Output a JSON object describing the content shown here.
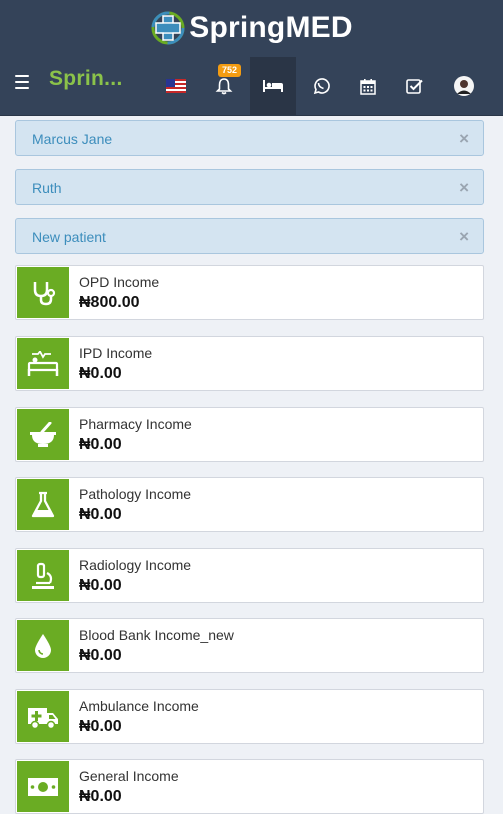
{
  "app": {
    "logo_text": "SpringMED",
    "brand_short": "Sprin..."
  },
  "nav": {
    "items": [
      {
        "name": "us-flag-icon"
      },
      {
        "name": "notifications-bell-icon",
        "badge": "752"
      },
      {
        "name": "bed-icon"
      },
      {
        "name": "whatsapp-icon"
      },
      {
        "name": "calendar-icon"
      },
      {
        "name": "tasks-checkbox-icon"
      },
      {
        "name": "user-avatar"
      }
    ]
  },
  "tabs": [
    {
      "label": "Marcus Jane",
      "close": "×"
    },
    {
      "label": "Ruth",
      "close": "×"
    },
    {
      "label": "New patient",
      "close": "×"
    }
  ],
  "income_cards": [
    {
      "title": "OPD Income",
      "value": "₦800.00",
      "icon": "stethoscope-icon"
    },
    {
      "title": "IPD Income",
      "value": "₦0.00",
      "icon": "hospital-bed-icon"
    },
    {
      "title": "Pharmacy Income",
      "value": "₦0.00",
      "icon": "mortar-pestle-icon"
    },
    {
      "title": "Pathology Income",
      "value": "₦0.00",
      "icon": "flask-icon"
    },
    {
      "title": "Radiology Income",
      "value": "₦0.00",
      "icon": "microscope-icon"
    },
    {
      "title": "Blood Bank Income_new",
      "value": "₦0.00",
      "icon": "blood-drop-icon"
    },
    {
      "title": "Ambulance Income",
      "value": "₦0.00",
      "icon": "ambulance-icon"
    },
    {
      "title": "General Income",
      "value": "₦0.00",
      "icon": "money-bill-icon"
    }
  ],
  "colors": {
    "header_bg": "#344359",
    "accent_green": "#6aac23",
    "brand_green": "#8bc34a",
    "badge": "#f39c12",
    "tab_bg": "#d4e4f1"
  }
}
